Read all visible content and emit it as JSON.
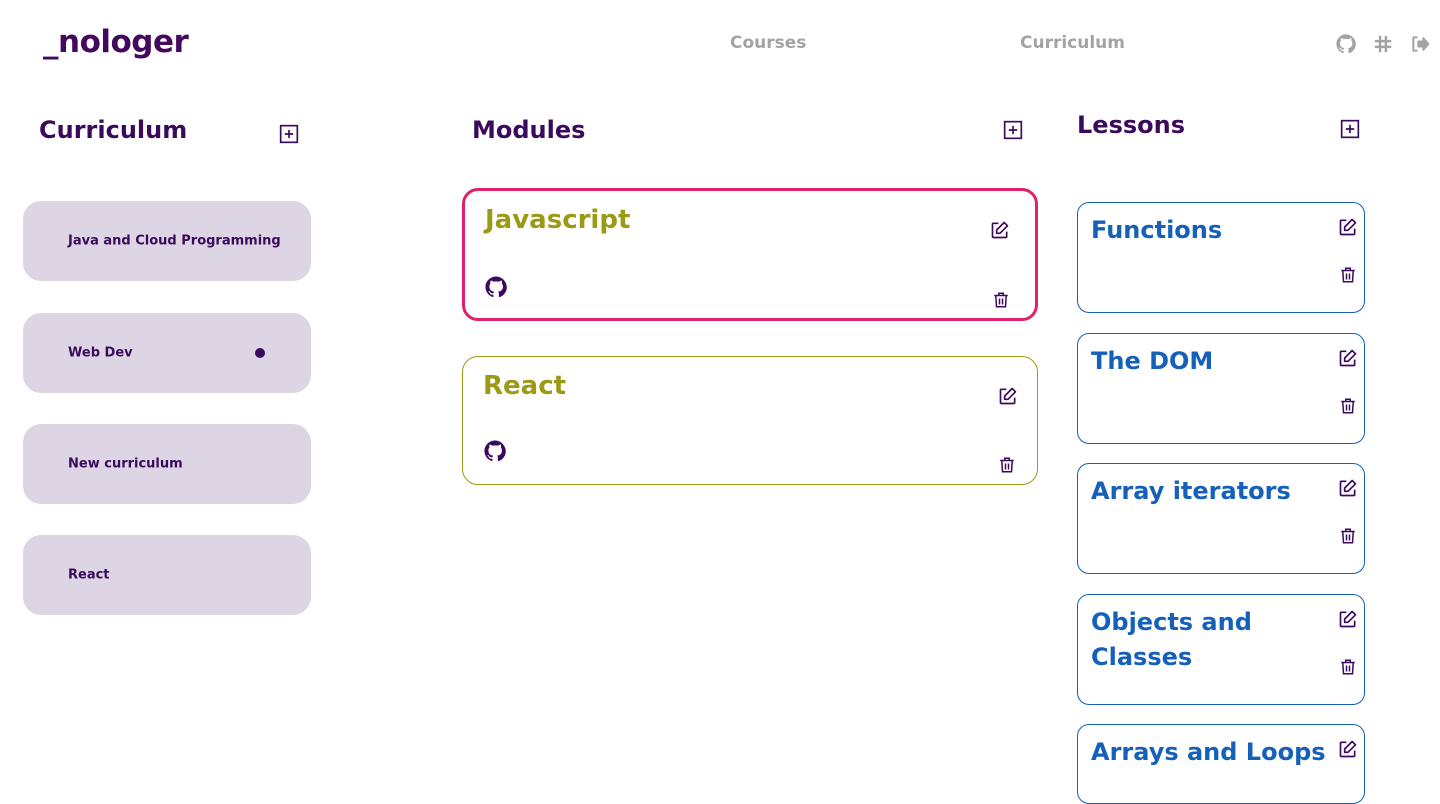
{
  "app": {
    "logo": "_nologer"
  },
  "nav": {
    "courses": "Courses",
    "curriculum": "Curriculum"
  },
  "header_icons": [
    "github-icon",
    "slack-icon",
    "logout-icon"
  ],
  "curriculum": {
    "title": "Curriculum",
    "items": [
      {
        "label": "Java and Cloud Programming",
        "active": false
      },
      {
        "label": "Web Dev",
        "active": true
      },
      {
        "label": "New curriculum",
        "active": false
      },
      {
        "label": "React",
        "active": false
      }
    ]
  },
  "modules": {
    "title": "Modules",
    "items": [
      {
        "title": "Javascript",
        "selected": true
      },
      {
        "title": "React",
        "selected": false
      }
    ]
  },
  "lessons": {
    "title": "Lessons",
    "items": [
      {
        "title": "Functions"
      },
      {
        "title": "The DOM"
      },
      {
        "title": "Array iterators"
      },
      {
        "title": "Objects and Classes"
      },
      {
        "title": "Arrays and Loops"
      }
    ]
  },
  "colors": {
    "brand": "#44095c",
    "nav_text": "#a3a3a3",
    "curriculum_card_bg": "#ddd5e3",
    "module_accent": "#9a9a14",
    "module_selected_border": "#e0216b",
    "lesson_accent": "#1560b8"
  }
}
